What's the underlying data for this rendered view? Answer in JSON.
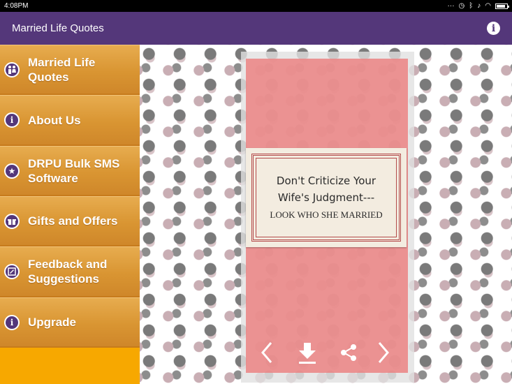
{
  "status_bar": {
    "time": "4:08PM"
  },
  "app_bar": {
    "title": "Married Life Quotes"
  },
  "drawer": {
    "items": [
      {
        "label_line1": "Married Life",
        "label_line2": "Quotes"
      },
      {
        "label_line1": "About Us",
        "label_line2": ""
      },
      {
        "label_line1": "DRPU Bulk SMS",
        "label_line2": "Software"
      },
      {
        "label_line1": "Gifts and Offers",
        "label_line2": ""
      },
      {
        "label_line1": "Feedback and",
        "label_line2": "Suggestions"
      },
      {
        "label_line1": "Upgrade",
        "label_line2": ""
      }
    ]
  },
  "quote": {
    "line1": "Don't Criticize Your",
    "line2": "Wife's Judgment---",
    "line3": "LOOK WHO SHE MARRIED"
  },
  "colors": {
    "app_bar": "#54377a",
    "drawer": "#f7a800",
    "card_pink": "#eb8282"
  },
  "icons": {
    "couple": "couple-icon",
    "info": "info-icon",
    "star": "star-icon",
    "gift": "gift-icon",
    "feedback": "feedback-icon",
    "prev": "chevron-left-icon",
    "next": "chevron-right-icon",
    "download": "download-icon",
    "share": "share-icon"
  }
}
